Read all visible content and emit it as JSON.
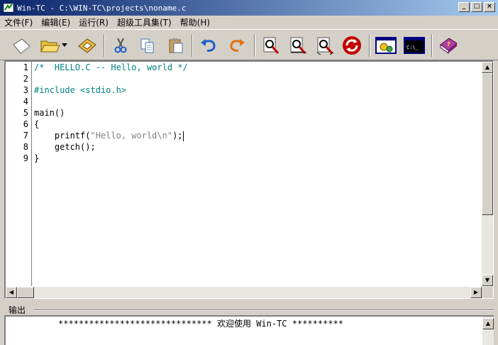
{
  "window": {
    "title": "Win-TC - C:\\WIN-TC\\projects\\noname.c",
    "minimize_glyph": "_",
    "maximize_glyph": "□",
    "close_glyph": "×"
  },
  "menu": [
    {
      "label": "文件(F)"
    },
    {
      "label": "编辑(E)"
    },
    {
      "label": "运行(R)"
    },
    {
      "label": "超级工具集(T)"
    },
    {
      "label": "帮助(H)"
    }
  ],
  "toolbar": {
    "icons": [
      "new-file-icon",
      "open-folder-icon",
      "save-disk-icon",
      "cut-scissors-icon",
      "copy-icon",
      "paste-icon",
      "undo-icon",
      "redo-icon",
      "find-icon",
      "find-next-icon",
      "replace-icon",
      "refresh-icon",
      "compile-icon",
      "console-icon",
      "help-book-icon"
    ],
    "console_glyph": "C:\\_"
  },
  "editor": {
    "line_numbers": [
      "1",
      "2",
      "3",
      "4",
      "5",
      "6",
      "7",
      "8",
      "9"
    ],
    "lines": {
      "l1": "/*  HELLO.C -- Hello, world */",
      "l3": "#include <stdio.h>",
      "l5": "main()",
      "l6": "{",
      "l7_a": "    printf(",
      "l7_b": "\"Hello, world\\n\"",
      "l7_c": ");",
      "l8": "    getch();",
      "l9": "}"
    }
  },
  "output": {
    "label": "输出",
    "message": "****************************** 欢迎使用 Win-TC **********"
  },
  "colors": {
    "title_start": "#0a246a",
    "title_end": "#a6caf0",
    "comment": "#008080",
    "window_bg": "#d4d0c8"
  }
}
